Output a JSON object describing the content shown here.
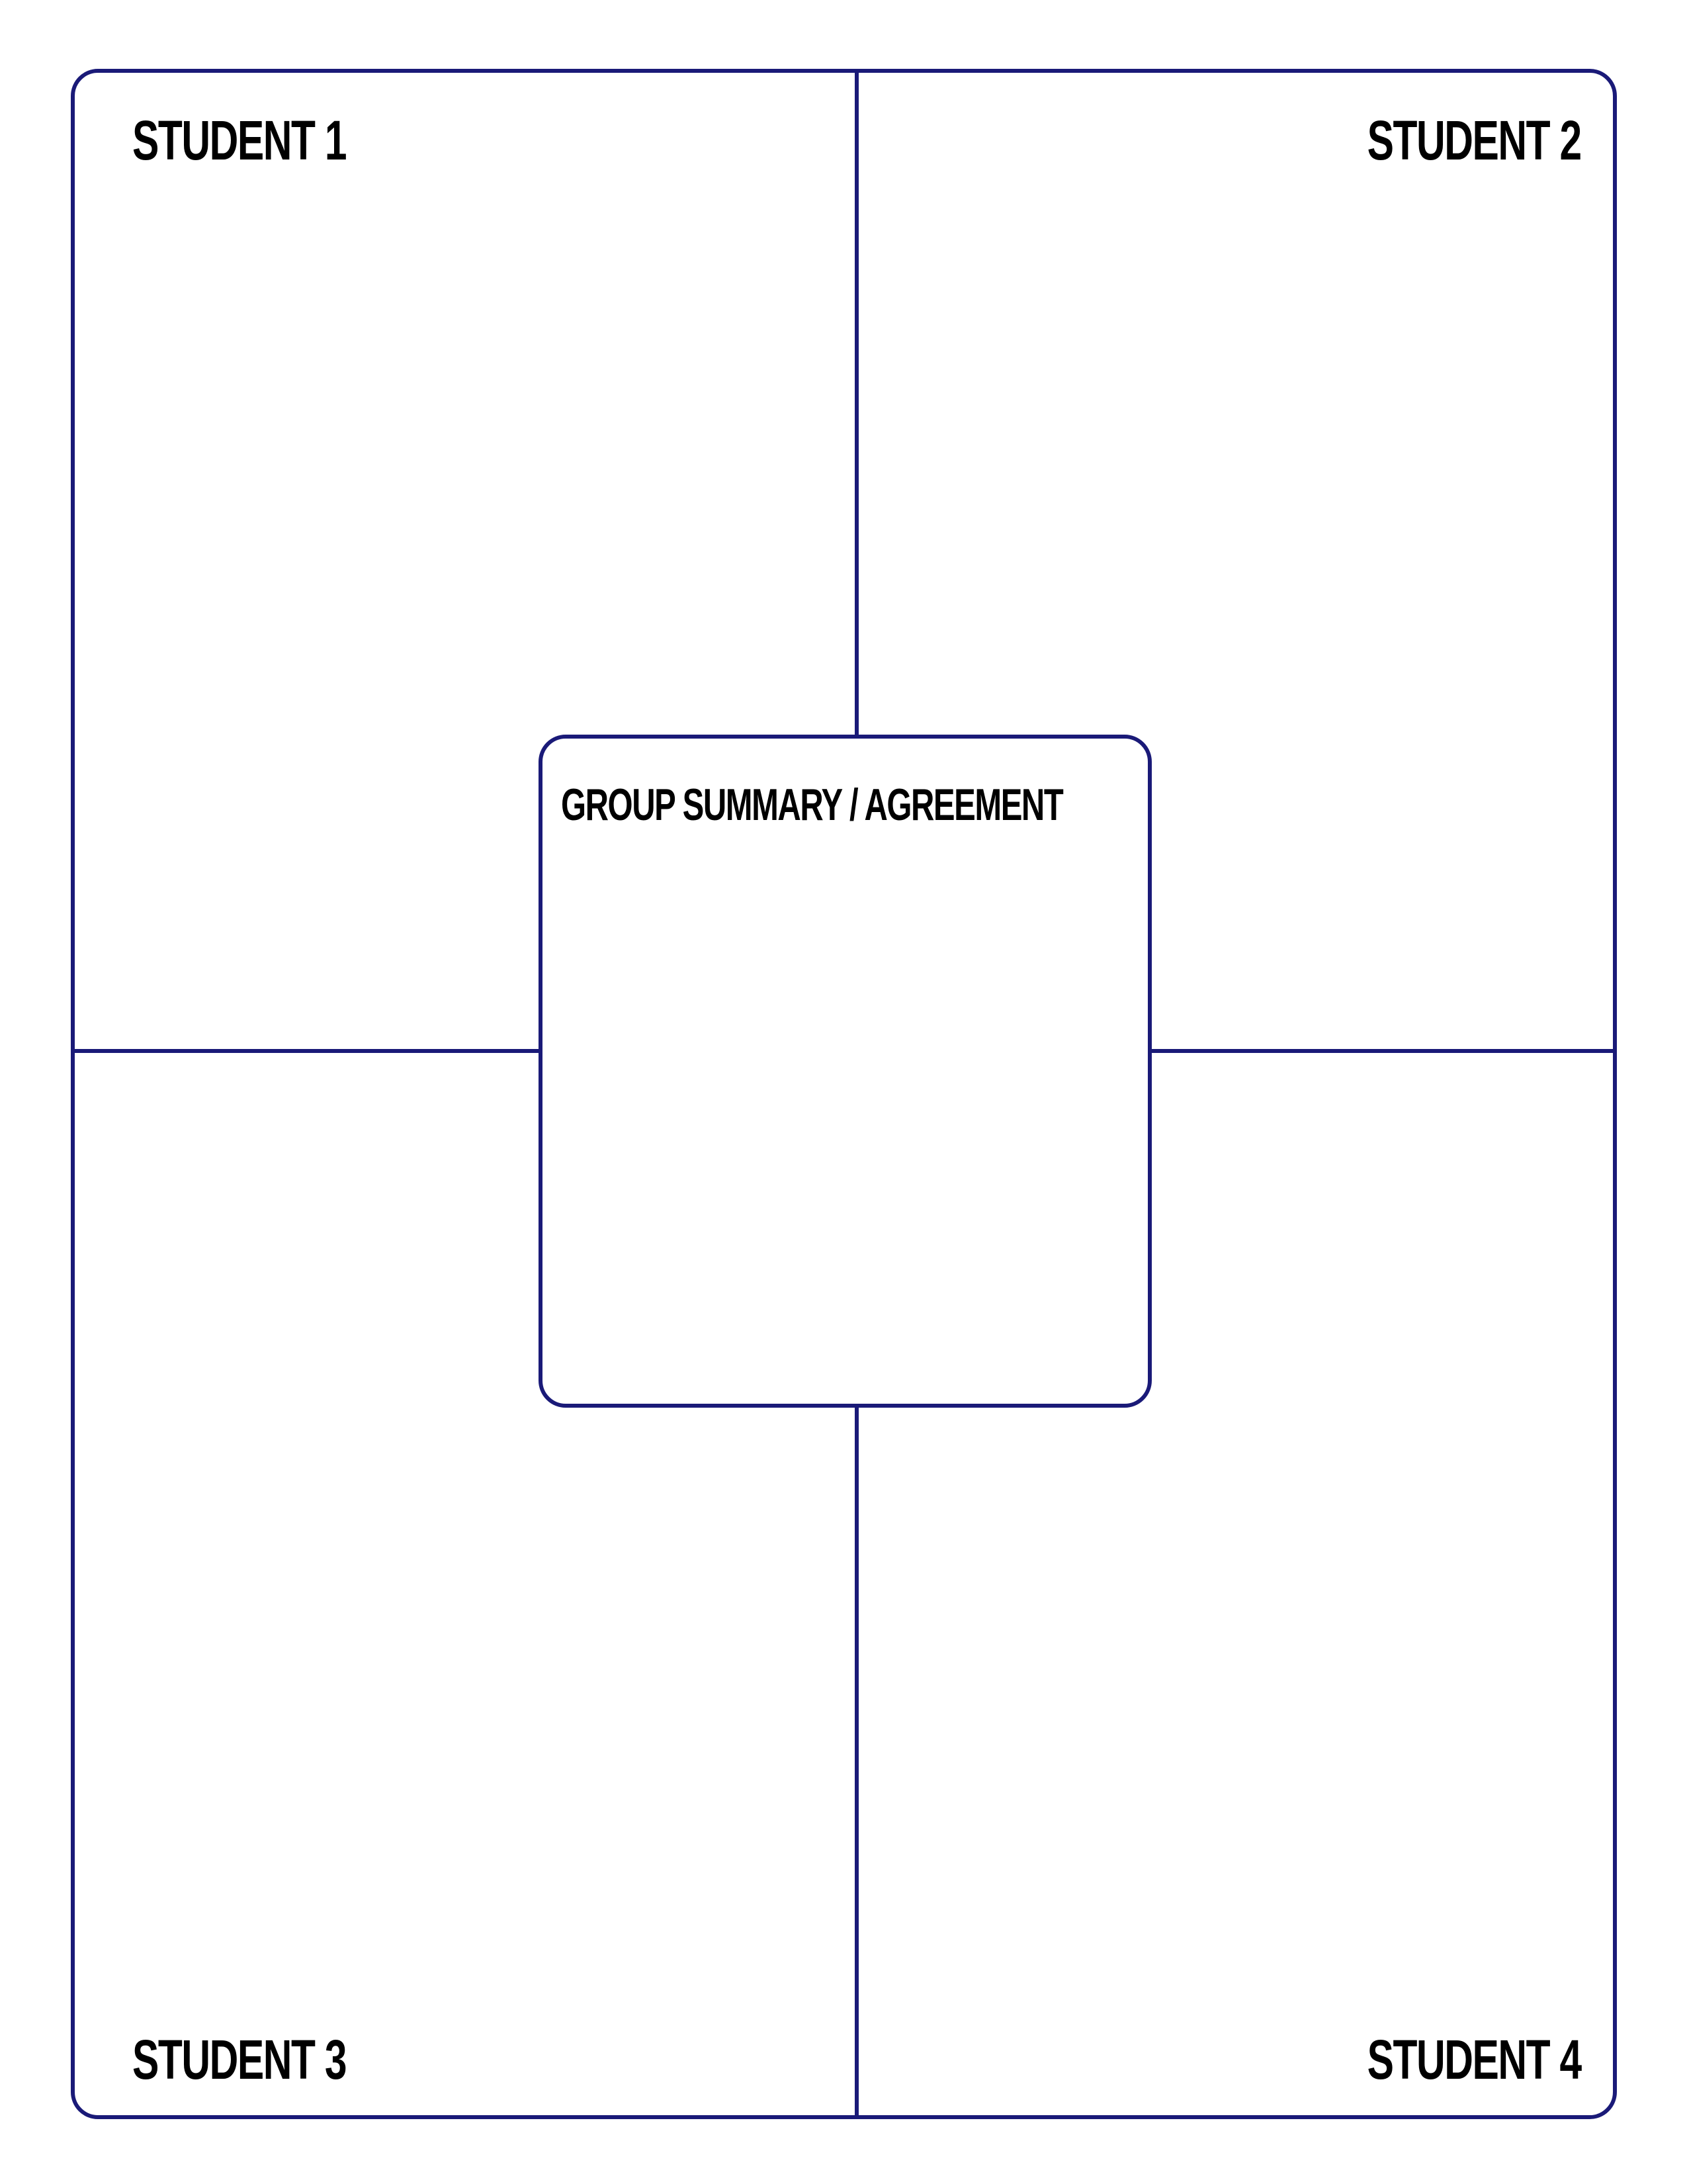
{
  "organizer": {
    "student_1_label": "STUDENT 1",
    "student_2_label": "STUDENT 2",
    "student_3_label": "STUDENT 3",
    "student_4_label": "STUDENT 4",
    "center_label": "GROUP SUMMARY / AGREEMENT",
    "line_color": "#1a1a78"
  }
}
